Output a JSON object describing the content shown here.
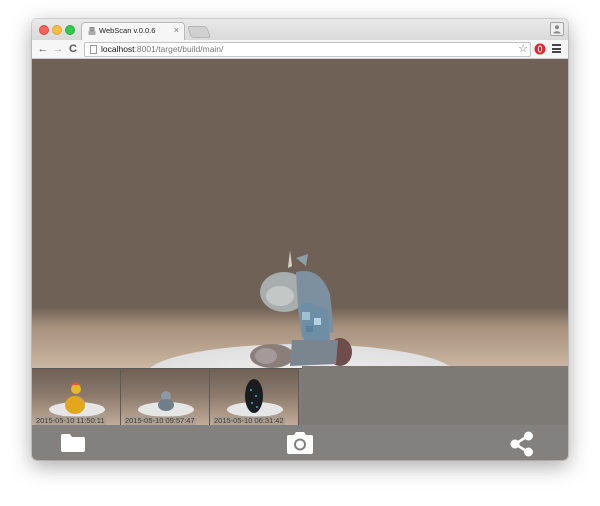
{
  "browser": {
    "tab": {
      "title": "WebScan v.0.0.6",
      "close_glyph": "×",
      "icon": "robot-icon"
    },
    "nav": {
      "back": "←",
      "forward": "→",
      "reload": "C"
    },
    "address": {
      "host": "localhost",
      "path": ":8001/target/build/main/"
    },
    "star_glyph": "☆"
  },
  "app": {
    "thumbnails": [
      {
        "timestamp": "2015-05-10 11:50:11",
        "model": "yellow-duck"
      },
      {
        "timestamp": "2015-05-10 09:57:47",
        "model": "small-gray-figure"
      },
      {
        "timestamp": "2015-05-10 06:31:42",
        "model": "dark-speckled-object"
      }
    ],
    "footer": {
      "left": "folder-icon",
      "center": "camera-icon",
      "right": "share-icon"
    }
  },
  "colors": {
    "viewport_bg": "#6f6155",
    "floor": "#c3ae9a",
    "footer_bg": "#838180",
    "footer_icon": "#ffffff"
  }
}
